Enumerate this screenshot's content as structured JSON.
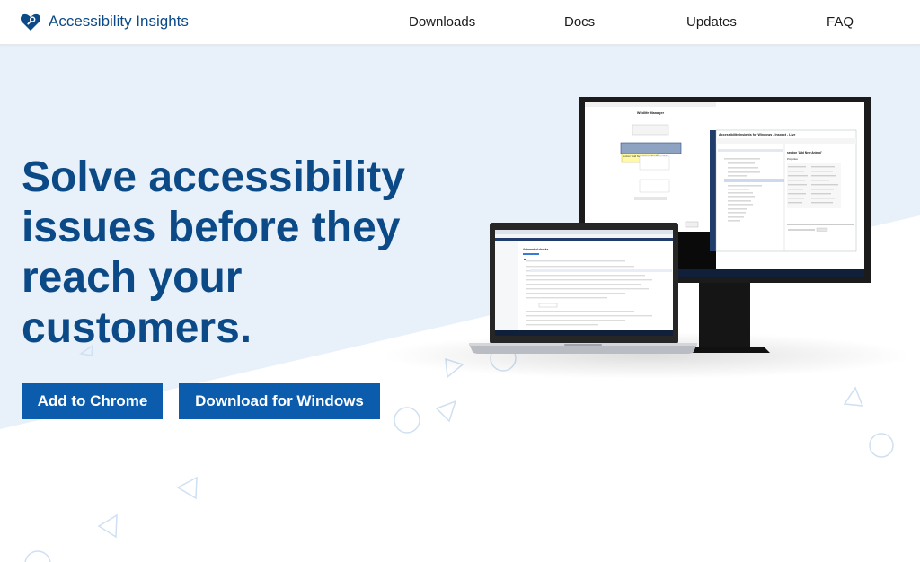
{
  "brand": {
    "name": "Accessibility Insights",
    "logo_icon": "heart-magnifier-icon",
    "color": "#0b4a86"
  },
  "nav": {
    "items": [
      {
        "label": "Downloads"
      },
      {
        "label": "Docs"
      },
      {
        "label": "Updates"
      },
      {
        "label": "FAQ"
      }
    ]
  },
  "hero": {
    "headline": "Solve accessibility issues before they reach your customers.",
    "buttons": {
      "chrome": "Add to Chrome",
      "windows": "Download for Windows"
    },
    "accent": "#0b5cad",
    "background": "#e8f0fa"
  },
  "monitor_app": {
    "title": "Accessibility Insights for Windows - Inspect - Live",
    "dialog_title": "Wildlife Manager",
    "properties_heading": "Properties",
    "selected_element": "section 'Add New Animal'",
    "tooltip": "section 'Add New Animal' Not Focusable"
  },
  "laptop_app": {
    "title": "Automated checks"
  }
}
